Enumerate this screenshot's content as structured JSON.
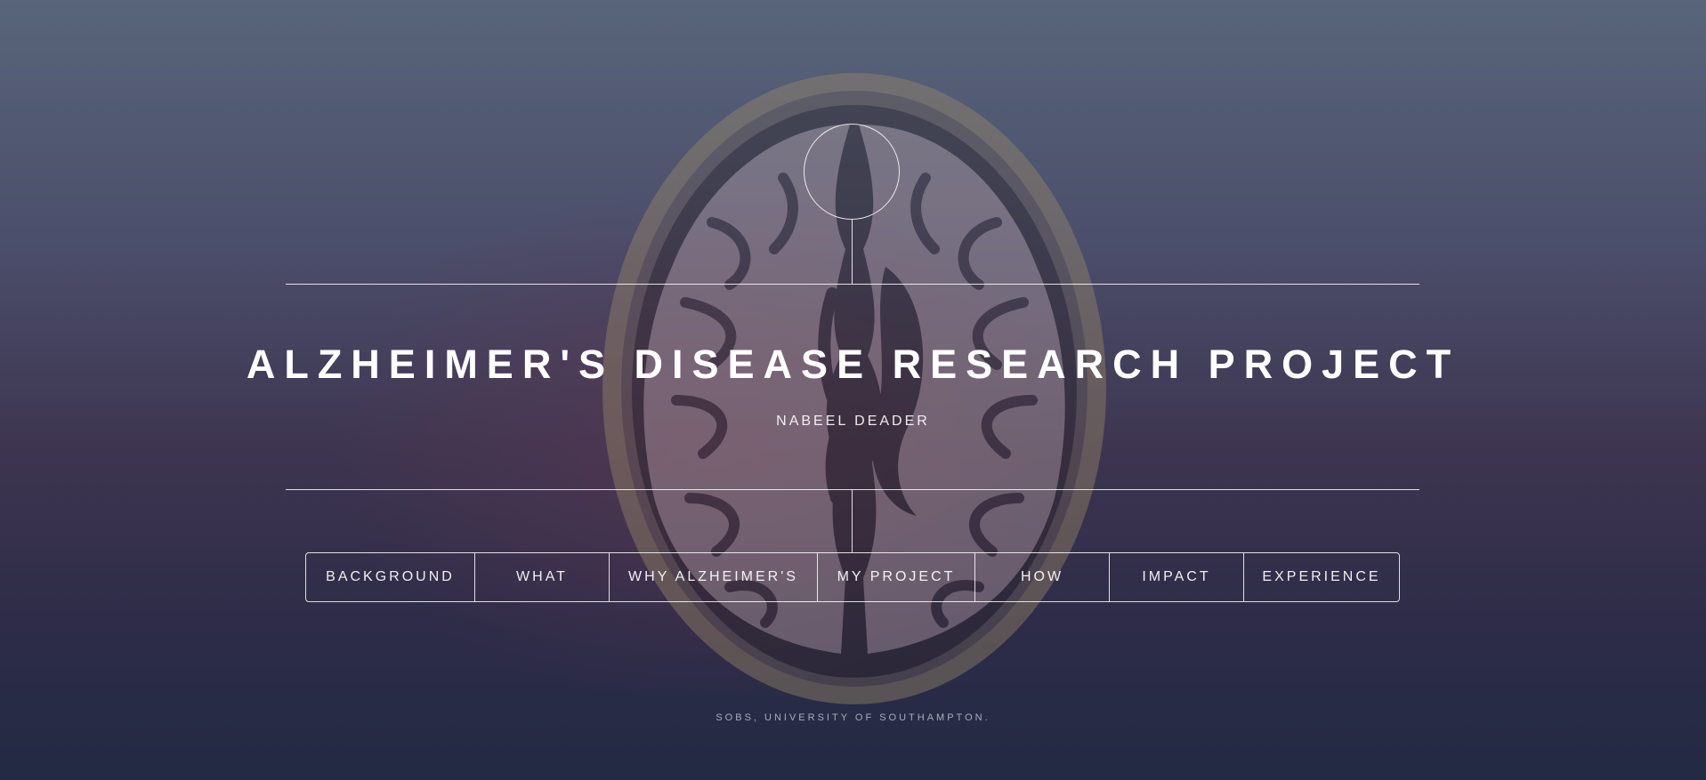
{
  "header": {
    "title": "ALZHEIMER'S DISEASE RESEARCH PROJECT",
    "subtitle": "NABEEL DEADER"
  },
  "nav": {
    "items": [
      {
        "label": "BACKGROUND"
      },
      {
        "label": "WHAT"
      },
      {
        "label": "WHY ALZHEIMER'S"
      },
      {
        "label": "MY PROJECT"
      },
      {
        "label": "HOW"
      },
      {
        "label": "IMPACT"
      },
      {
        "label": "EXPERIENCE"
      }
    ]
  },
  "footer": {
    "text": "SOBS, UNIVERSITY OF SOUTHAMPTON."
  },
  "colors": {
    "text": "#ffffff",
    "background_top": "#58657a",
    "background_bottom": "#222a44"
  },
  "icons": {
    "background_image": "brain-scan-illustration",
    "logo": "circle-logo"
  }
}
